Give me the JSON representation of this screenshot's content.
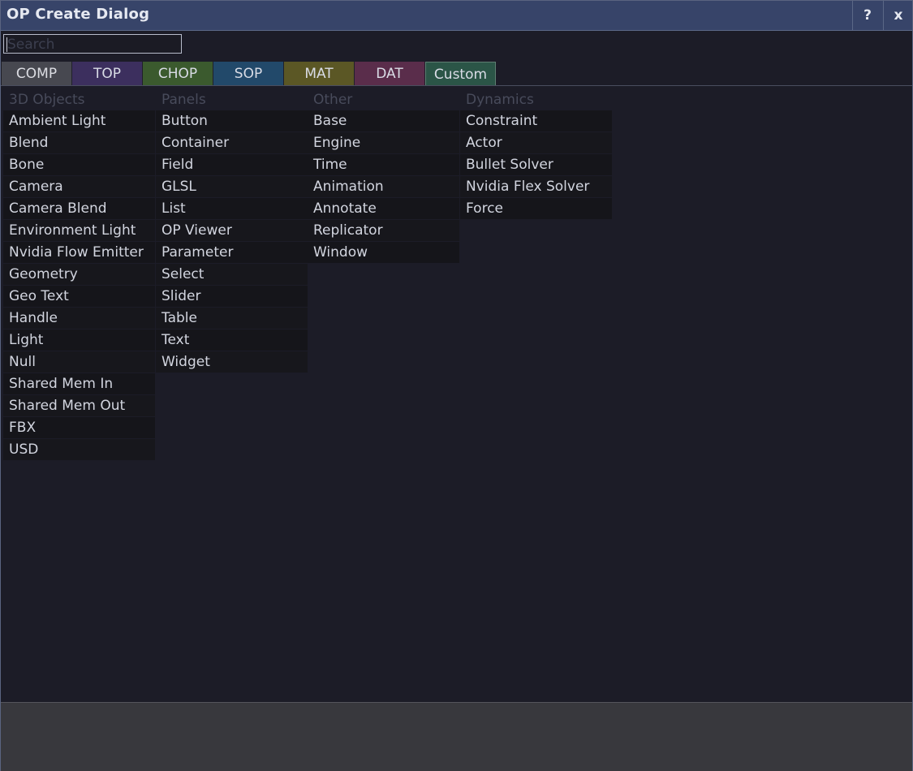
{
  "window": {
    "title": "OP Create Dialog",
    "help_label": "?",
    "close_label": "x"
  },
  "search": {
    "placeholder": "Search",
    "value": ""
  },
  "tabs": [
    {
      "label": "COMP",
      "color": "#474850",
      "selected": true
    },
    {
      "label": "TOP",
      "color": "#3c2f5e"
    },
    {
      "label": "CHOP",
      "color": "#3b5a2e"
    },
    {
      "label": "SOP",
      "color": "#22496a"
    },
    {
      "label": "MAT",
      "color": "#5b5725"
    },
    {
      "label": "DAT",
      "color": "#5a2d4b"
    },
    {
      "label": "Custom",
      "color": "#2b5547"
    }
  ],
  "columns": [
    {
      "header": "3D Objects",
      "items": [
        "Ambient Light",
        "Blend",
        "Bone",
        "Camera",
        "Camera Blend",
        "Environment Light",
        "Nvidia Flow Emitter",
        "Geometry",
        "Geo Text",
        "Handle",
        "Light",
        "Null",
        "Shared Mem In",
        "Shared Mem Out",
        "FBX",
        "USD"
      ]
    },
    {
      "header": "Panels",
      "items": [
        "Button",
        "Container",
        "Field",
        "GLSL",
        "List",
        "OP Viewer",
        "Parameter",
        "Select",
        "Slider",
        "Table",
        "Text",
        "Widget"
      ]
    },
    {
      "header": "Other",
      "items": [
        "Base",
        "Engine",
        "Time",
        "Animation",
        "Annotate",
        "Replicator",
        "Window"
      ]
    },
    {
      "header": "Dynamics",
      "items": [
        "Constraint",
        "Actor",
        "Bullet Solver",
        "Nvidia Flex Solver",
        "Force"
      ]
    }
  ]
}
